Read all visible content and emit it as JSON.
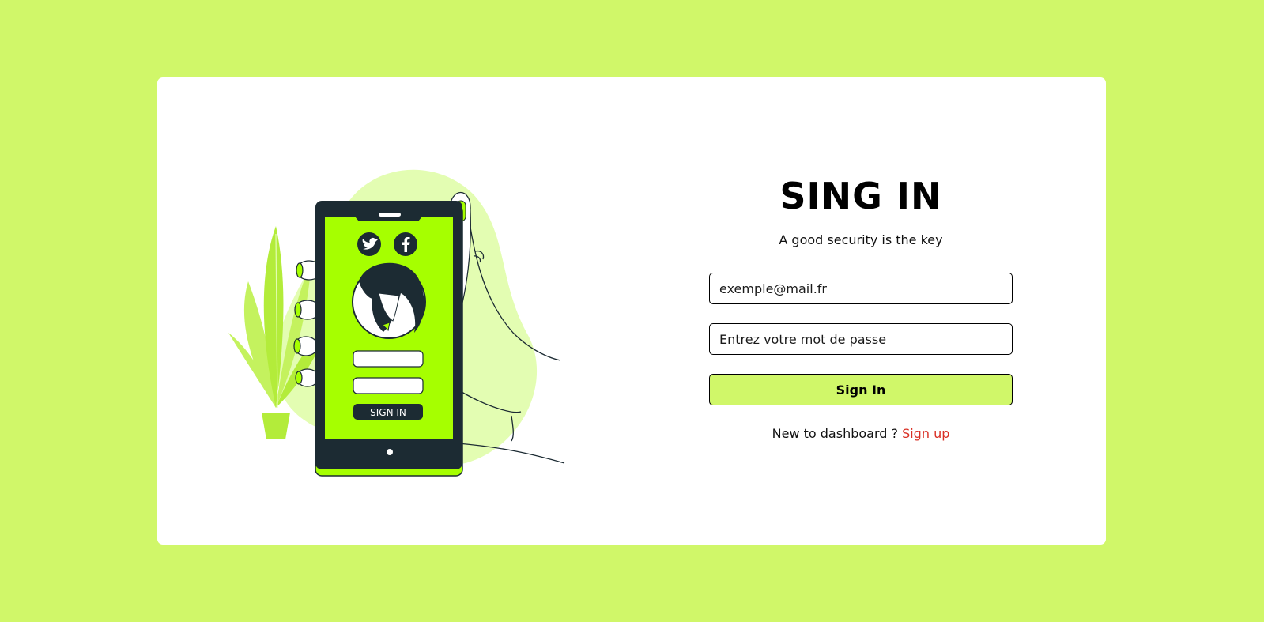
{
  "login": {
    "title": "SING IN",
    "subtitle": "A good security is the key",
    "email_placeholder": "exemple@mail.fr",
    "password_placeholder": "Entrez votre mot de passe",
    "submit_label": "Sign In",
    "signup_prompt": "New to dashboard ? ",
    "signup_link": "Sign up"
  },
  "illustration": {
    "phone_button_label": "SIGN IN"
  },
  "colors": {
    "background": "#d0f769",
    "accent": "#a6ff00",
    "dark": "#1c2b33",
    "link": "#d93025"
  },
  "icons": [
    "twitter-icon",
    "facebook-icon"
  ]
}
